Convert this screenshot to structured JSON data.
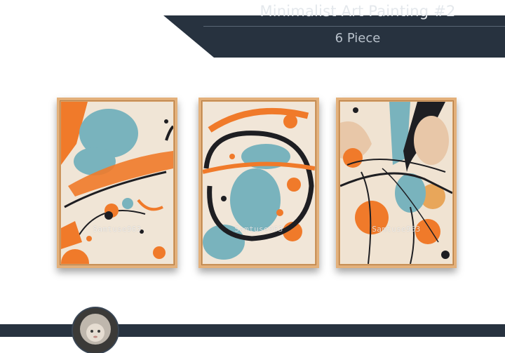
{
  "header": {
    "title": "Minimalist Art Painting #2",
    "subtitle": "6 Piece"
  },
  "paintings": [
    {
      "watermark": "Samtuse963"
    },
    {
      "watermark": "Samtuse963"
    },
    {
      "watermark": "Samtuse963"
    }
  ],
  "colors": {
    "header_dark": "#27323f",
    "accent_orange": "#f07a2a",
    "teal": "#79b3bd",
    "black_ink": "#1e1e22",
    "canvas": "#f1e6d8",
    "frame_wood": "#d9a46c"
  },
  "footer": {
    "avatar": "avatar-doll-photo"
  }
}
